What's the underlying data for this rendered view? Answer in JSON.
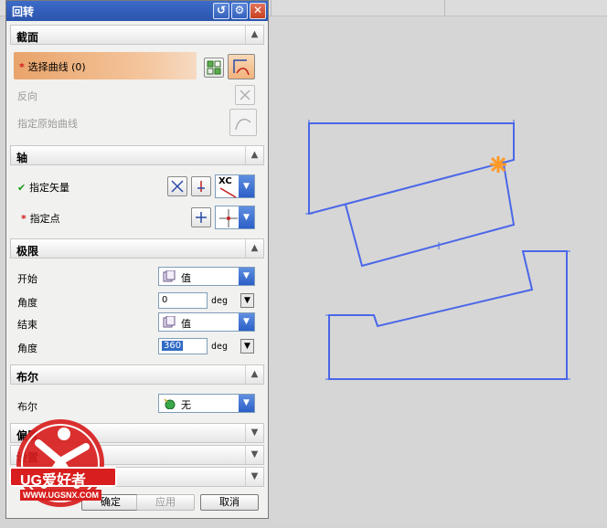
{
  "dialog": {
    "title": "回转",
    "title_buttons": [
      "reset-icon",
      "gear-icon",
      "close-icon"
    ]
  },
  "sections": {
    "section_curve": {
      "title": "截面",
      "select_curve_label": "选择曲线 (0)",
      "reverse_label": "反向",
      "specify_origin_curve_label": "指定原始曲线"
    },
    "axis": {
      "title": "轴",
      "specify_vector_label": "指定矢量",
      "specify_point_label": "指定点",
      "vector_value": "XC"
    },
    "limits": {
      "title": "极限",
      "start_label": "开始",
      "start_mode": "值",
      "start_angle_label": "角度",
      "start_angle_value": "0",
      "end_label": "结束",
      "end_mode": "值",
      "end_angle_label": "角度",
      "end_angle_value": "360",
      "unit": "deg"
    },
    "boolean": {
      "title": "布尔",
      "label": "布尔",
      "value": "无"
    },
    "collapsed": [
      "偏置",
      "设置",
      "预览"
    ]
  },
  "buttons": {
    "ok": "确定",
    "apply": "应用",
    "cancel": "取消"
  },
  "watermark": {
    "brand": "UG爱好者",
    "url": "WWW.UGSNX.COM"
  },
  "colors": {
    "titlebar": "#2c55ad",
    "selection_highlight": "#e9a46a",
    "curve": "#4a67e8",
    "marker": "#ff9a2a",
    "logo_red": "#d81e1e"
  }
}
